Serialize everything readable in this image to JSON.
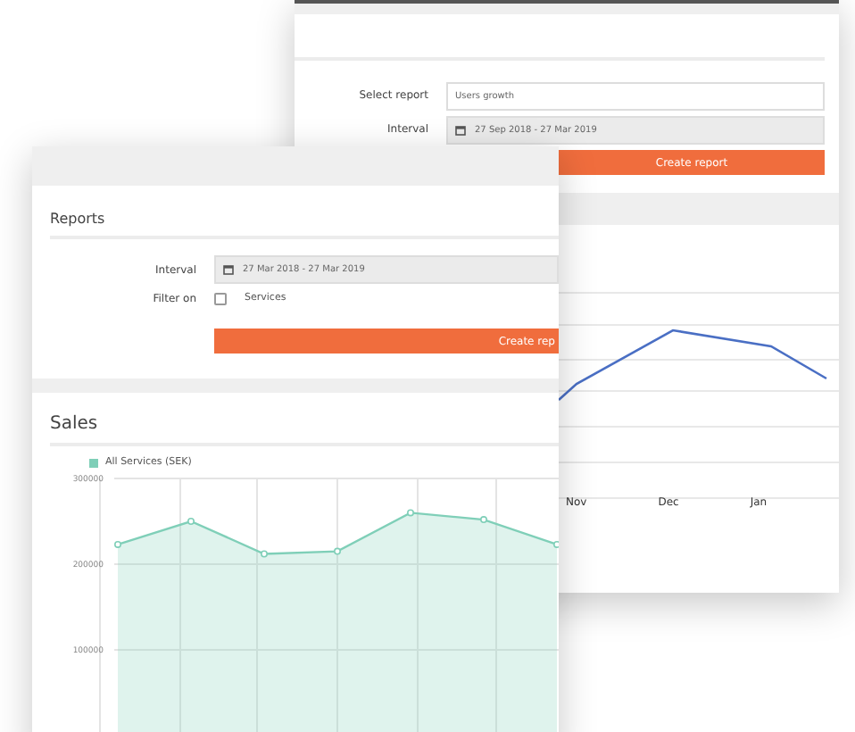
{
  "back_window": {
    "select_report": {
      "label": "Select report",
      "value": "Users growth"
    },
    "interval": {
      "label": "Interval",
      "value": "27 Sep 2018 - 27 Mar 2019"
    },
    "create_button": "Create report",
    "trend_chart": {
      "x_labels": [
        "Nov",
        "Dec",
        "Jan"
      ]
    }
  },
  "front_window": {
    "reports": {
      "title": "Reports",
      "interval": {
        "label": "Interval",
        "value": "27 Mar 2018 - 27 Mar 2019"
      },
      "filter": {
        "label": "Filter on",
        "option": "Services",
        "checked": false
      },
      "create_button": "Create rep"
    },
    "sales": {
      "title": "Sales",
      "chart_data": {
        "type": "area",
        "series": [
          {
            "name": "All Services (SEK)",
            "color": "#7fcfb8",
            "values": [
              223000,
              250000,
              212000,
              215000,
              260000,
              252000,
              223000
            ]
          }
        ],
        "ylim": [
          0,
          300000
        ],
        "yticks": [
          100000,
          200000,
          300000
        ],
        "grid": true
      }
    }
  }
}
